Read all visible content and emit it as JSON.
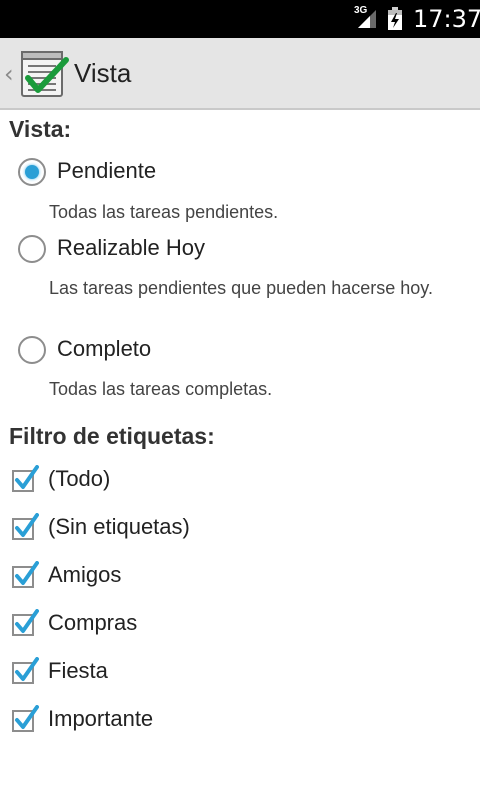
{
  "status_bar": {
    "network": "3G",
    "time": "17:37"
  },
  "action_bar": {
    "title": "Vista"
  },
  "view_section": {
    "header": "Vista:",
    "options": [
      {
        "label": "Pendiente",
        "summary": "Todas las tareas pendientes.",
        "checked": true
      },
      {
        "label": "Realizable Hoy",
        "summary": "Las tareas pendientes que pueden hacerse hoy.",
        "checked": false
      },
      {
        "label": "Completo",
        "summary": "Todas las tareas completas.",
        "checked": false
      }
    ]
  },
  "filter_section": {
    "header": "Filtro de etiquetas:",
    "items": [
      {
        "label": "(Todo)",
        "checked": true
      },
      {
        "label": "(Sin etiquetas)",
        "checked": true
      },
      {
        "label": "Amigos",
        "checked": true
      },
      {
        "label": "Compras",
        "checked": true
      },
      {
        "label": "Fiesta",
        "checked": true
      },
      {
        "label": "Importante",
        "checked": true
      }
    ]
  },
  "colors": {
    "accent": "#2a9fd6",
    "action_bar": "#e5e5e5",
    "status_bar": "#000000"
  }
}
